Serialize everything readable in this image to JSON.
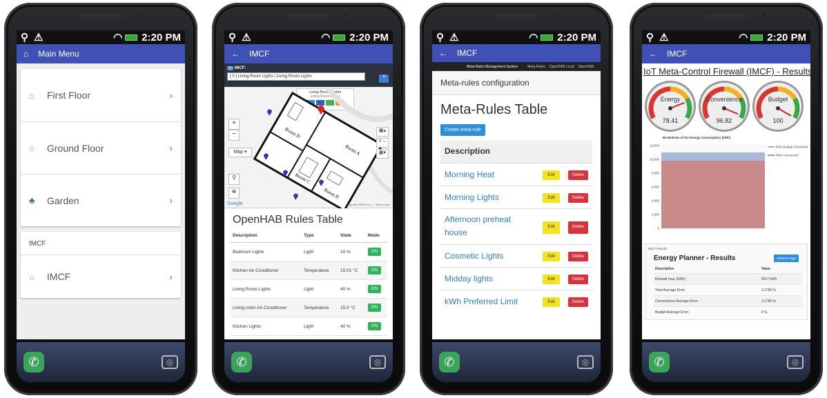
{
  "status": {
    "time": "2:20 PM"
  },
  "phone1": {
    "title": "Main Menu",
    "items": [
      {
        "label": "First Floor"
      },
      {
        "label": "Ground Floor"
      },
      {
        "label": "Garden"
      }
    ],
    "section": "IMCF",
    "section_item": "IMCF"
  },
  "phone2": {
    "title": "IMCF",
    "map_header": "IMCF:",
    "map_select": "[ 0 ] Living Room Lights | Living Room Lights",
    "popup_title": "Living Room Lights",
    "popup_sub": "Living Room Lights",
    "map_type": "Map",
    "google": "Google",
    "map_footer": "Map data ©2020   5 m ——   Terms of Use",
    "rooms": [
      "Room D",
      "Room A",
      "Room B",
      "Room C"
    ],
    "table_title": "OpenHAB Rules Table",
    "columns": [
      "Description",
      "Type",
      "State",
      "Mode"
    ],
    "rows": [
      {
        "desc": "Bedroom Lights",
        "type": "Light",
        "state": "10 %",
        "mode": "ON"
      },
      {
        "desc": "Kitchen Air-Conditioner",
        "type": "Temperature",
        "state": "15.01 °C",
        "mode": "ON"
      },
      {
        "desc": "Living Room Lights",
        "type": "Light",
        "state": "40 %",
        "mode": "ON"
      },
      {
        "desc": "Living room Air-Conditioner",
        "type": "Temperature",
        "state": "15.0 °C",
        "mode": "ON"
      },
      {
        "desc": "Kitchen Lights",
        "type": "Light",
        "state": "40 %",
        "mode": "ON"
      }
    ]
  },
  "phone3": {
    "title": "IMCF",
    "nav_brand": "Meta-Rules Management System",
    "nav_links": [
      "Meta-Rules",
      "OpenHAB Local",
      "OpenHAB"
    ],
    "config_title": "Meta-rules configuration",
    "table_title": "Meta-Rules Table",
    "create_btn": "Create meta-rule",
    "column": "Description",
    "edit_label": "Edit",
    "delete_label": "Delete",
    "rules": [
      "Morning Heat",
      "Morning Lights",
      "Afternoon preheat house",
      "Cosmetic Lights",
      "Midday lights",
      "kWh Preferred Limit"
    ]
  },
  "phone4": {
    "title": "IMCF",
    "page_title": "IoT Meta-Control Firewall (IMCF) - Results",
    "gauges": [
      {
        "label": "Energy",
        "value": "78.41",
        "level": 78.41
      },
      {
        "label": "Convenience",
        "value": "96.82",
        "level": 96.82
      },
      {
        "label": "Budget",
        "value": "100",
        "level": 100
      }
    ],
    "results_caption": "IMCF Results",
    "planner_title": "Energy Planner - Results",
    "refresh_btn": "Refresh Page",
    "columns": [
      "Description",
      "Value"
    ],
    "rows": [
      {
        "desc": "Kilowatt hour (kWh):",
        "value": "9017 kWh"
      },
      {
        "desc": "Total Average Error:",
        "value": "3.1784 %"
      },
      {
        "desc": "Convenience Average Error:",
        "value": "3.1784 %"
      },
      {
        "desc": "Budget Average Error:",
        "value": "0 %"
      }
    ]
  },
  "chart_data": {
    "type": "area",
    "title": "Breakdown of the Energy Consumption (kWh)",
    "y_ticks": [
      "0",
      "2,000",
      "4,000",
      "6,000",
      "8,000",
      "10,000",
      "12,000"
    ],
    "ylim": [
      0,
      12000
    ],
    "series": [
      {
        "name": "kWh Budget Threshold",
        "value": 11000,
        "color": "#9db3d8"
      },
      {
        "name": "kWh Consumed",
        "value": 9800,
        "color": "#c98a8a"
      }
    ],
    "legend": "right"
  }
}
